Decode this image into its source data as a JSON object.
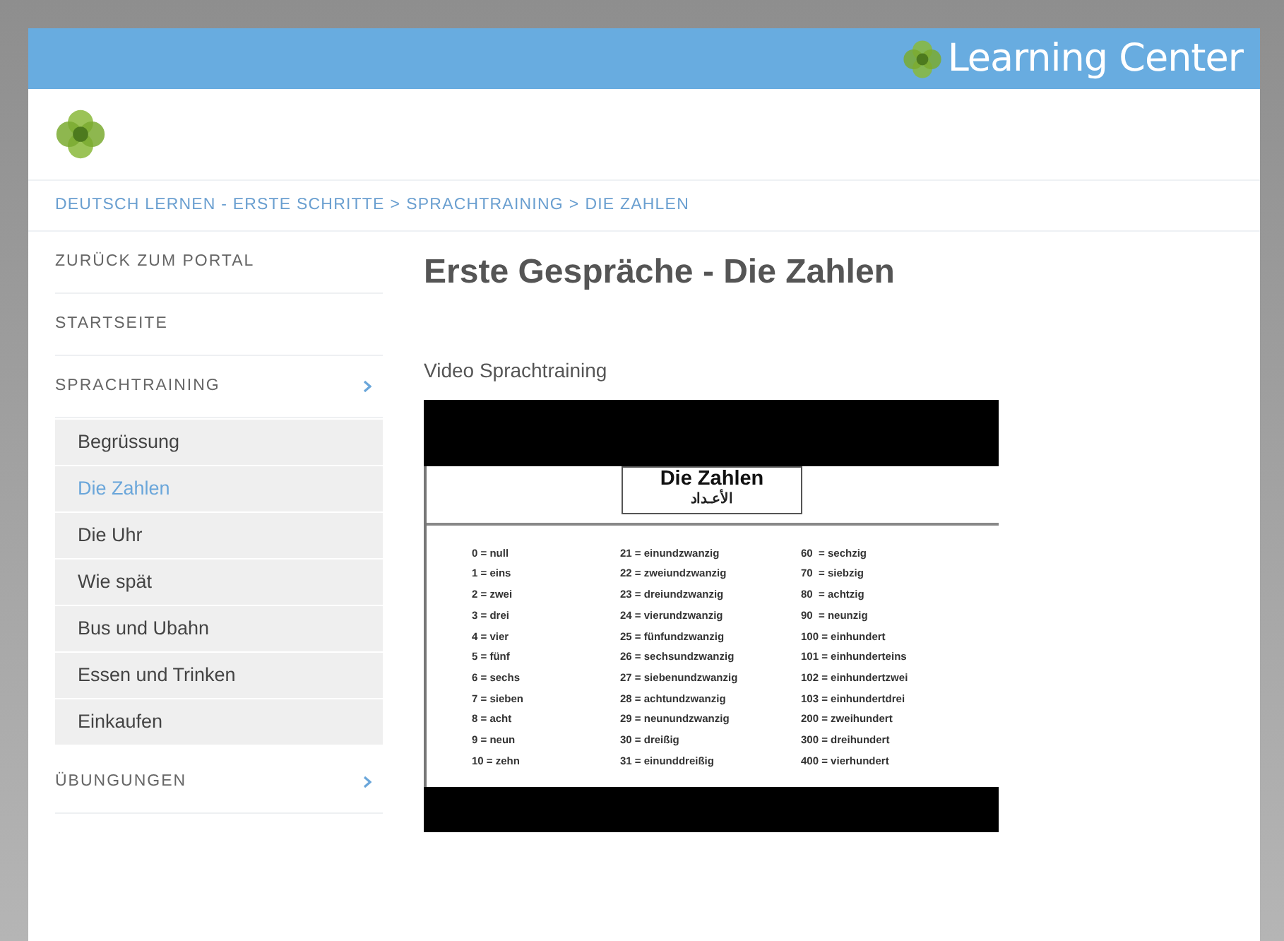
{
  "header": {
    "brand": "Learning Center"
  },
  "breadcrumb": {
    "separator": ">",
    "items": [
      {
        "label": "DEUTSCH LERNEN - ERSTE SCHRITTE"
      },
      {
        "label": "SPRACHTRAINING"
      },
      {
        "label": "DIE ZAHLEN"
      }
    ]
  },
  "sidebar": {
    "items": [
      {
        "label": "ZURÜCK ZUM PORTAL",
        "expandable": false
      },
      {
        "label": "STARTSEITE",
        "expandable": false
      },
      {
        "label": "SPRACHTRAINING",
        "expandable": true,
        "children": [
          {
            "label": "Begrüssung",
            "selected": false
          },
          {
            "label": "Die Zahlen",
            "selected": true
          },
          {
            "label": "Die Uhr",
            "selected": false
          },
          {
            "label": "Wie spät",
            "selected": false
          },
          {
            "label": "Bus und Ubahn",
            "selected": false
          },
          {
            "label": "Essen und Trinken",
            "selected": false
          },
          {
            "label": "Einkaufen",
            "selected": false
          }
        ]
      },
      {
        "label": "ÜBUNGUNGEN",
        "expandable": true
      }
    ]
  },
  "content": {
    "title": "Erste Gespräche - Die Zahlen",
    "section_label": "Video Sprachtraining",
    "video": {
      "slide_title": "Die Zahlen",
      "slide_subtitle": "الأعـداد",
      "columns": [
        [
          "0 = null",
          "1 = eins",
          "2 = zwei",
          "3 = drei",
          "4 = vier",
          "5 = fünf",
          "6 = sechs",
          "7 = sieben",
          "8 = acht",
          "9 = neun",
          "10 = zehn"
        ],
        [
          "21 = einundzwanzig",
          "22 = zweiundzwanzig",
          "23 = dreiundzwanzig",
          "24 = vierundzwanzig",
          "25 = fünfundzwanzig",
          "26 = sechsundzwanzig",
          "27 = siebenundzwanzig",
          "28 = achtundzwanzig",
          "29 = neunundzwanzig",
          "30 = dreißig",
          "31 = einunddreißig"
        ],
        [
          "60  = sechzig",
          "70  = siebzig",
          "80  = achtzig",
          "90  = neunzig",
          "100 = einhundert",
          "101 = einhunderteins",
          "102 = einhundertzwei",
          "103 = einhundertdrei",
          "200 = zweihundert",
          "300 = dreihundert",
          "400 = vierhundert"
        ]
      ]
    }
  }
}
